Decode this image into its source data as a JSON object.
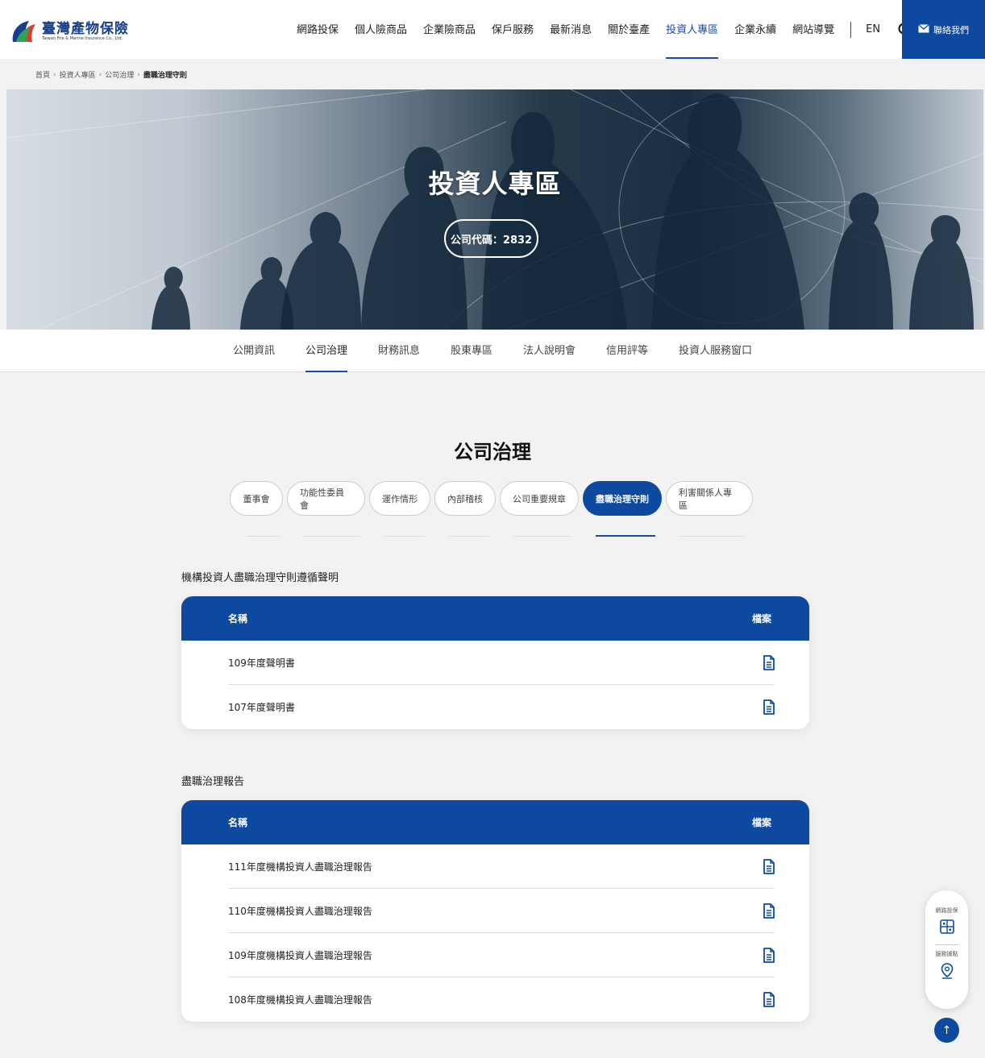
{
  "brand": {
    "name_cn": "臺灣產物保險",
    "name_en": "Taiwan Fire & Marine Insurance Co., Ltd.",
    "color": "#0d4a9f"
  },
  "header": {
    "nav": [
      "網路投保",
      "個人險商品",
      "企業險商品",
      "保戶服務",
      "最新消息",
      "關於臺產",
      "投資人專區",
      "企業永續",
      "網站導覽"
    ],
    "active_nav": "投資人專區",
    "lang": "EN",
    "contact_label": "聯絡我們"
  },
  "breadcrumb": [
    "首頁",
    "投資人專區",
    "公司治理",
    "盡職治理守則"
  ],
  "hero": {
    "title": "投資人專區",
    "code_label": "公司代碼：2832"
  },
  "subnav": {
    "items": [
      "公開資訊",
      "公司治理",
      "財務訊息",
      "股東專區",
      "法人說明會",
      "信用評等",
      "投資人服務窗口"
    ],
    "active": "公司治理"
  },
  "section": {
    "title": "公司治理",
    "pills": [
      "董事會",
      "功能性委員會",
      "運作情形",
      "內部稽核",
      "公司重要規章",
      "盡職治理守則",
      "利害關係人專區"
    ],
    "active_pill": "盡職治理守則"
  },
  "tables": [
    {
      "heading": "機構投資人盡職治理守則遵循聲明",
      "col_name": "名稱",
      "col_file": "檔案",
      "rows": [
        "109年度聲明書",
        "107年度聲明書"
      ]
    },
    {
      "heading": "盡職治理報告",
      "col_name": "名稱",
      "col_file": "檔案",
      "rows": [
        "111年度機構投資人盡職治理報告",
        "110年度機構投資人盡職治理報告",
        "109年度機構投資人盡職治理報告",
        "108年度機構投資人盡職治理報告"
      ]
    }
  ],
  "floating": {
    "item1_label": "網路投保",
    "item1_icon": "grid-icon",
    "item2_label": "服務據點",
    "item2_icon": "location-pin-icon",
    "top_label": "↑"
  }
}
